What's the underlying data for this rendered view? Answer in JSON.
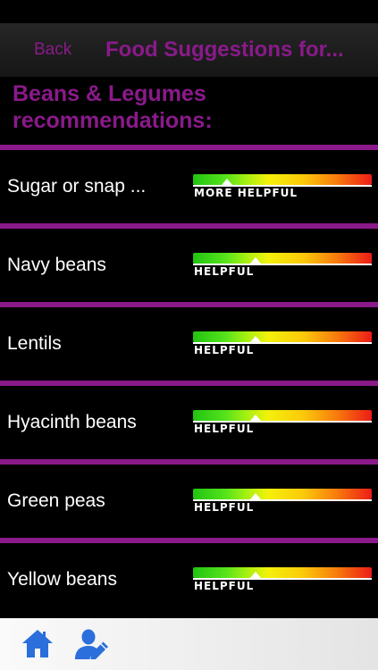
{
  "nav": {
    "back_label": "Back",
    "title": "Food Suggestions for..."
  },
  "section": {
    "heading_line1": "Beans & Legumes",
    "heading_line2": "recommendations:"
  },
  "foods": [
    {
      "name": "Sugar or snap ...",
      "rating": "MORE HELPFUL",
      "indicator": 0.19
    },
    {
      "name": "Navy beans",
      "rating": "HELPFUL",
      "indicator": 0.35
    },
    {
      "name": "Lentils",
      "rating": "HELPFUL",
      "indicator": 0.35
    },
    {
      "name": "Hyacinth beans",
      "rating": "HELPFUL",
      "indicator": 0.35
    },
    {
      "name": "Green peas",
      "rating": "HELPFUL",
      "indicator": 0.35
    },
    {
      "name": "Yellow beans",
      "rating": "HELPFUL",
      "indicator": 0.35
    }
  ],
  "tabbar": {
    "home_icon": "home-icon",
    "profile_icon": "profile-edit-icon"
  },
  "colors": {
    "accent": "#8a1a8a",
    "tab_icon": "#2a6fdb"
  }
}
